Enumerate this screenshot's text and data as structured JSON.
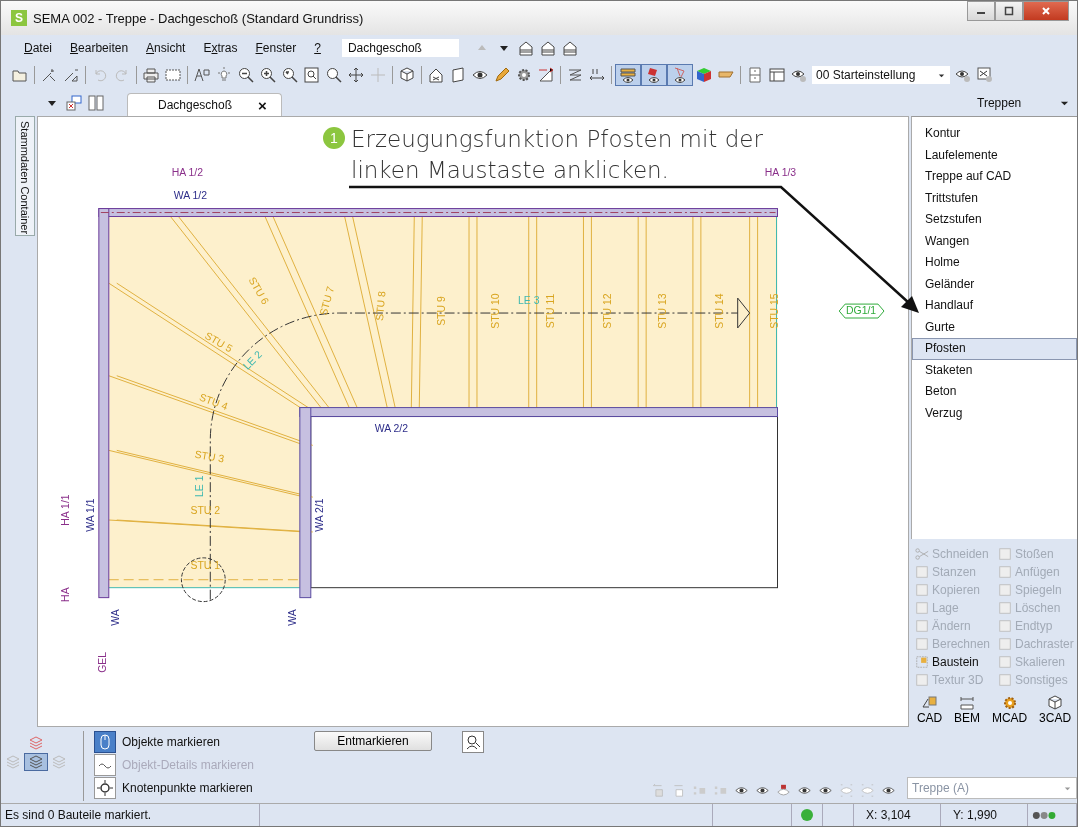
{
  "window": {
    "logo": "S",
    "title": "SEMA  002 - Treppe  - Dachgeschoß (Standard Grundriss)"
  },
  "menu": [
    {
      "key": "D",
      "after": "atei"
    },
    {
      "key": "B",
      "after": "earbeiten"
    },
    {
      "key": "A",
      "after": "nsicht"
    },
    {
      "before": "E",
      "key": "x",
      "after": "tras"
    },
    {
      "key": "F",
      "after": "enster"
    },
    {
      "key": "?"
    }
  ],
  "floor_select": {
    "value": "Dachgeschoß"
  },
  "view_toggles": [
    {
      "selected": true
    },
    {
      "selected": true
    },
    {
      "selected": true
    }
  ],
  "view_preset": {
    "value": "00 Starteinstellung"
  },
  "side_tab": "Stammdaten Container",
  "doc_tab": {
    "label": "Dachgeschoß",
    "close": "×"
  },
  "callout": {
    "number": "1",
    "text": "Erzeugungsfunktion Pfosten mit der linken Maustaste anklicken."
  },
  "drawing": {
    "labels": [
      {
        "text": "HA 1/2",
        "kind": "axis"
      },
      {
        "text": "WA 1/2",
        "kind": "wall"
      },
      {
        "text": "HA 1/3",
        "kind": "axis"
      },
      {
        "text": "STU 6",
        "kind": "step"
      },
      {
        "text": "STU 7",
        "kind": "step"
      },
      {
        "text": "STU 8",
        "kind": "step"
      },
      {
        "text": "STU 9",
        "kind": "step"
      },
      {
        "text": "STU 10",
        "kind": "step"
      },
      {
        "text": "STU 11",
        "kind": "step"
      },
      {
        "text": "STU 12",
        "kind": "step"
      },
      {
        "text": "STU 13",
        "kind": "step"
      },
      {
        "text": "STU 14",
        "kind": "step"
      },
      {
        "text": "STU 15",
        "kind": "step"
      },
      {
        "text": "LE 3",
        "kind": "line"
      },
      {
        "text": "STU 5",
        "kind": "step"
      },
      {
        "text": "LE 2",
        "kind": "line"
      },
      {
        "text": "STU 4",
        "kind": "step"
      },
      {
        "text": "STU 3",
        "kind": "step"
      },
      {
        "text": "LE 1",
        "kind": "line"
      },
      {
        "text": "STU 2",
        "kind": "step"
      },
      {
        "text": "STU 1",
        "kind": "step"
      },
      {
        "text": "WA 2/2",
        "kind": "wall"
      },
      {
        "text": "HA 1/1",
        "kind": "axis"
      },
      {
        "text": "WA 1/1",
        "kind": "wall"
      },
      {
        "text": "WA 2/1",
        "kind": "wall"
      },
      {
        "text": "HA",
        "kind": "axis"
      },
      {
        "text": "WA",
        "kind": "wall"
      },
      {
        "text": "WA",
        "kind": "wall"
      },
      {
        "text": "GEL",
        "kind": "axis"
      },
      {
        "text": "DG1/1",
        "kind": "post"
      }
    ]
  },
  "panel": {
    "title": "Treppen",
    "items": [
      {
        "label": "Kontur",
        "selected": false
      },
      {
        "label": "Laufelemente",
        "selected": false
      },
      {
        "label": "Treppe auf CAD",
        "selected": false
      },
      {
        "label": "Trittstufen",
        "selected": false
      },
      {
        "label": "Setzstufen",
        "selected": false
      },
      {
        "label": "Wangen",
        "selected": false
      },
      {
        "label": "Holme",
        "selected": false
      },
      {
        "label": "Geländer",
        "selected": false
      },
      {
        "label": "Handlauf",
        "selected": false
      },
      {
        "label": "Gurte",
        "selected": false
      },
      {
        "label": "Pfosten",
        "selected": true
      },
      {
        "label": "Staketen",
        "selected": false
      },
      {
        "label": "Beton",
        "selected": false
      },
      {
        "label": "Verzug",
        "selected": false
      }
    ]
  },
  "tools": [
    {
      "label": "Schneiden",
      "disabled": true
    },
    {
      "label": "Stoßen",
      "disabled": true
    },
    {
      "label": "Stanzen",
      "disabled": true
    },
    {
      "label": "Anfügen",
      "disabled": true
    },
    {
      "label": "Kopieren",
      "disabled": true
    },
    {
      "label": "Spiegeln",
      "disabled": true
    },
    {
      "label": "Lage",
      "disabled": true
    },
    {
      "label": "Löschen",
      "disabled": true
    },
    {
      "label": "Ändern",
      "disabled": true
    },
    {
      "label": "Endtyp",
      "disabled": true
    },
    {
      "label": "Berechnen",
      "disabled": true
    },
    {
      "label": "Dachraster",
      "disabled": true
    },
    {
      "label": "Baustein",
      "disabled": false
    },
    {
      "label": "Skalieren",
      "disabled": true
    },
    {
      "label": "Textur 3D",
      "disabled": true
    },
    {
      "label": "Sonstiges",
      "disabled": true
    }
  ],
  "modules": [
    {
      "label": "CAD",
      "kind": "cad"
    },
    {
      "label": "BEM",
      "kind": "bem"
    },
    {
      "label": "MCAD",
      "kind": "mcad"
    },
    {
      "label": "3CAD",
      "kind": "cube"
    }
  ],
  "element_select": {
    "value": "Treppe  (A)",
    "disabled": true
  },
  "mark_options": [
    {
      "label": "Objekte markieren",
      "selected": true,
      "disabled": false
    },
    {
      "label": "Objekt-Details markieren",
      "selected": false,
      "disabled": true
    },
    {
      "label": "Knotenpunkte markieren",
      "selected": false,
      "disabled": false
    }
  ],
  "unmark_button": "Entmarkieren",
  "status": {
    "message": "Es sind 0 Bauteile markiert.",
    "x": "X: 3,104",
    "y": "Y: 1,990"
  }
}
